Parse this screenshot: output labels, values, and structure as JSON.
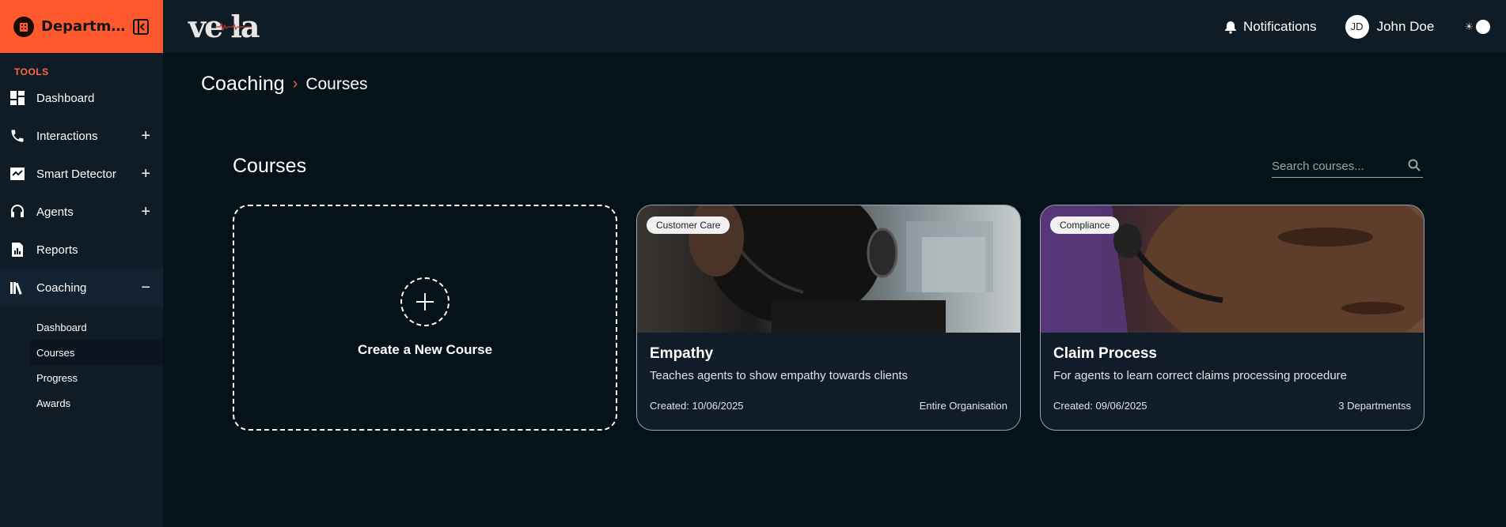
{
  "sidebar": {
    "department": "Departmen...",
    "section_label": "TOOLS",
    "items": [
      {
        "label": "Dashboard",
        "icon": "dashboard-icon",
        "expandable": false
      },
      {
        "label": "Interactions",
        "icon": "phone-icon",
        "expandable": true,
        "toggle": "+"
      },
      {
        "label": "Smart Detector",
        "icon": "chart-check-icon",
        "expandable": true,
        "toggle": "+"
      },
      {
        "label": "Agents",
        "icon": "headset-icon",
        "expandable": true,
        "toggle": "+"
      },
      {
        "label": "Reports",
        "icon": "report-icon",
        "expandable": false
      },
      {
        "label": "Coaching",
        "icon": "books-icon",
        "expandable": true,
        "toggle": "−"
      }
    ],
    "coaching_sub": [
      "Dashboard",
      "Courses",
      "Progress",
      "Awards"
    ],
    "active_sub": "Courses"
  },
  "topbar": {
    "logo": "ve la",
    "notifications": "Notifications",
    "user_initials": "JD",
    "user_name": "John Doe",
    "theme_icon": "☀"
  },
  "breadcrumb": {
    "root": "Coaching",
    "separator": "›",
    "current": "Courses"
  },
  "courses": {
    "title": "Courses",
    "search_placeholder": "Search courses...",
    "create_label": "Create a New Course",
    "items": [
      {
        "tag": "Customer Care",
        "title": "Empathy",
        "description": "Teaches agents to show empathy towards clients",
        "created": "Created: 10/06/2025",
        "scope": "Entire Organisation"
      },
      {
        "tag": "Compliance",
        "title": "Claim Process",
        "description": "For agents to learn correct claims processing procedure",
        "created": "Created: 09/06/2025",
        "scope": "3 Departmentss"
      }
    ]
  },
  "colors": {
    "accent": "#ff5a2d",
    "sidebar_bg": "#0f1c26",
    "main_bg": "#06121a"
  }
}
